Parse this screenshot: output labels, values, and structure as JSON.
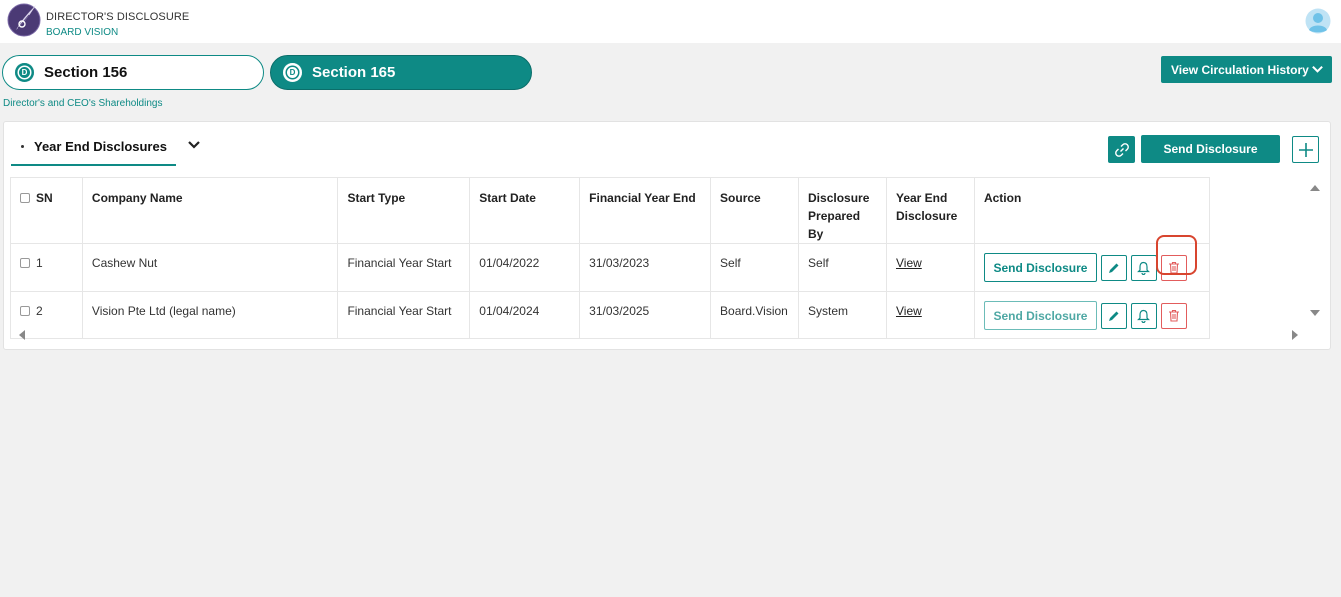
{
  "app": {
    "title": "DIRECTOR'S DISCLOSURE",
    "subtitle": "BOARD VISION",
    "logo_icon": "feather-logo-icon",
    "avatar_icon": "user-avatar-icon"
  },
  "sections": [
    {
      "badge": "D",
      "label": "Section 156",
      "active": false
    },
    {
      "badge": "D",
      "label": "Section 165",
      "active": true
    }
  ],
  "page_subtitle": "Director's and CEO's Shareholdings",
  "circulation_button": {
    "label": "View Circulation History",
    "icon": "chevron-down-icon"
  },
  "tab": {
    "label": "Year End Disclosures",
    "icon": "chevron-down-icon"
  },
  "toolbar": {
    "link_icon": "link-icon",
    "send_label": "Send Disclosure",
    "add_icon": "plus-icon"
  },
  "table": {
    "headers": {
      "sn": "SN",
      "company": "Company Name",
      "start_type": "Start Type",
      "start_date": "Start Date",
      "fy_end": "Financial Year End",
      "source": "Source",
      "prepared_by_1": "Disclosure",
      "prepared_by_2": "Prepared By",
      "ye_disclosure_1": "Year End",
      "ye_disclosure_2": "Disclosure",
      "action": "Action"
    },
    "rows": [
      {
        "sn": "1",
        "company": "Cashew Nut",
        "start_type": "Financial Year Start",
        "start_date": "01/04/2022",
        "fy_end": "31/03/2023",
        "source": "Self",
        "prepared_by": "Self",
        "ye_disclosure": "View",
        "send_label": "Send Disclosure"
      },
      {
        "sn": "2",
        "company": "Vision Pte Ltd (legal name)",
        "start_type": "Financial Year Start",
        "start_date": "01/04/2024",
        "fy_end": "31/03/2025",
        "source": "Board.Vision",
        "prepared_by": "System",
        "ye_disclosure": "View",
        "send_label": "Send Disclosure"
      }
    ]
  },
  "colors": {
    "accent": "#0e8a85",
    "danger": "#e25c5c",
    "highlight": "#d8452f"
  }
}
